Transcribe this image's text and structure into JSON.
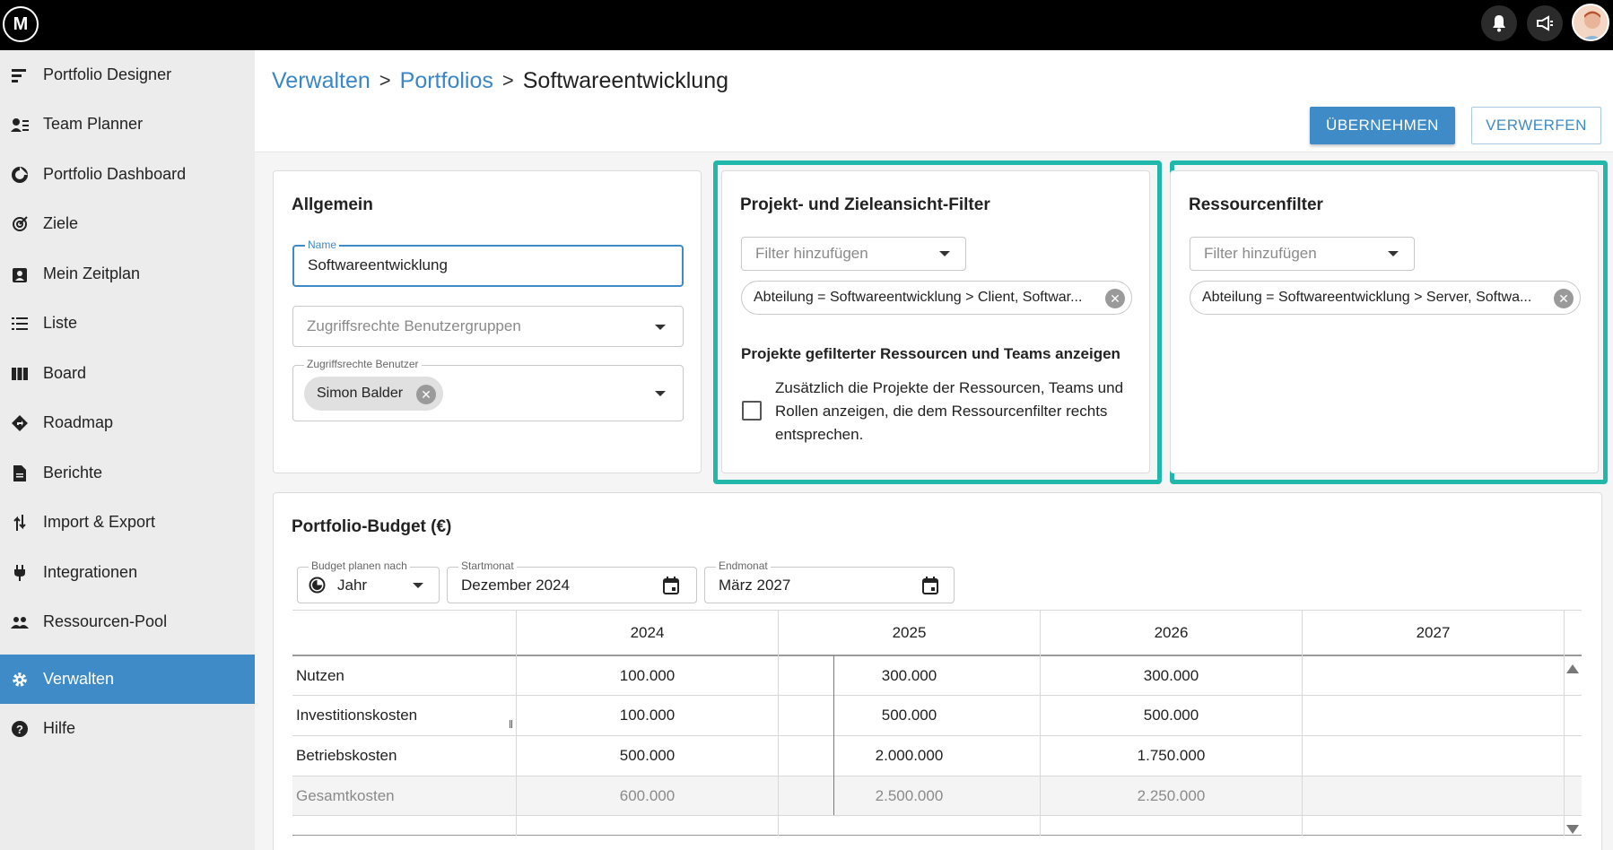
{
  "topbar": {
    "logo_icon": "masterplan-logo-icon",
    "notifications_icon": "bell-icon",
    "announcements_icon": "megaphone-icon",
    "avatar_icon": "user-avatar"
  },
  "sidebar": {
    "items": [
      {
        "label": "Portfolio Designer",
        "icon": "portfolio-designer-icon"
      },
      {
        "label": "Team Planner",
        "icon": "team-planner-icon"
      },
      {
        "label": "Portfolio Dashboard",
        "icon": "dashboard-icon"
      },
      {
        "label": "Ziele",
        "icon": "target-icon"
      },
      {
        "label": "Mein Zeitplan",
        "icon": "schedule-icon"
      },
      {
        "label": "Liste",
        "icon": "list-icon"
      },
      {
        "label": "Board",
        "icon": "board-icon"
      },
      {
        "label": "Roadmap",
        "icon": "roadmap-icon"
      },
      {
        "label": "Berichte",
        "icon": "report-icon"
      },
      {
        "label": "Import & Export",
        "icon": "import-export-icon"
      },
      {
        "label": "Integrationen",
        "icon": "plug-icon"
      },
      {
        "label": "Ressourcen-Pool",
        "icon": "people-icon"
      },
      {
        "label": "Verwalten",
        "icon": "gear-icon",
        "active": true
      },
      {
        "label": "Hilfe",
        "icon": "help-icon"
      }
    ],
    "active_color": "#3f8bc8"
  },
  "header": {
    "breadcrumb": [
      "Verwalten",
      "Portfolios",
      "Softwareentwicklung"
    ],
    "separator": ">",
    "apply_label": "ÜBERNEHMEN",
    "discard_label": "VERWERFEN"
  },
  "general": {
    "title": "Allgemein",
    "name_label": "Name",
    "name_value": "Softwareentwicklung",
    "group_rights_placeholder": "Zugriffsrechte Benutzergruppen",
    "user_rights_label": "Zugriffsrechte Benutzer",
    "user_chip": "Simon Balder"
  },
  "project_filter": {
    "title": "Projekt- und Zieleansicht-Filter",
    "add_placeholder": "Filter hinzufügen",
    "chip": "Abteilung = Softwareentwicklung > Client, Softwar...",
    "subtitle": "Projekte gefilterter Ressourcen und Teams anzeigen",
    "checkbox_text": "Zusätzlich die Projekte der Ressourcen, Teams und Rollen anzeigen, die dem Ressourcenfilter rechts entsprechen.",
    "checked": false
  },
  "resource_filter": {
    "title": "Ressourcenfilter",
    "add_placeholder": "Filter hinzufügen",
    "chip": "Abteilung = Softwareentwicklung > Server, Softwa..."
  },
  "highlight_color": "#1fb8aa",
  "budget": {
    "title": "Portfolio-Budget (€)",
    "plan_by_label": "Budget planen nach",
    "plan_by_value": "Jahr",
    "start_label": "Startmonat",
    "start_value": "Dezember 2024",
    "end_label": "Endmonat",
    "end_value": "März 2027",
    "columns": [
      "2024",
      "2025",
      "2026",
      "2027"
    ],
    "rows": [
      {
        "label": "Nutzen",
        "values": [
          "100.000",
          "300.000",
          "300.000",
          ""
        ]
      },
      {
        "label": "Investitionskosten",
        "values": [
          "100.000",
          "500.000",
          "500.000",
          ""
        ]
      },
      {
        "label": "Betriebskosten",
        "values": [
          "500.000",
          "2.000.000",
          "1.750.000",
          ""
        ]
      },
      {
        "label": "Gesamtkosten",
        "values": [
          "600.000",
          "2.500.000",
          "2.250.000",
          ""
        ]
      }
    ]
  }
}
